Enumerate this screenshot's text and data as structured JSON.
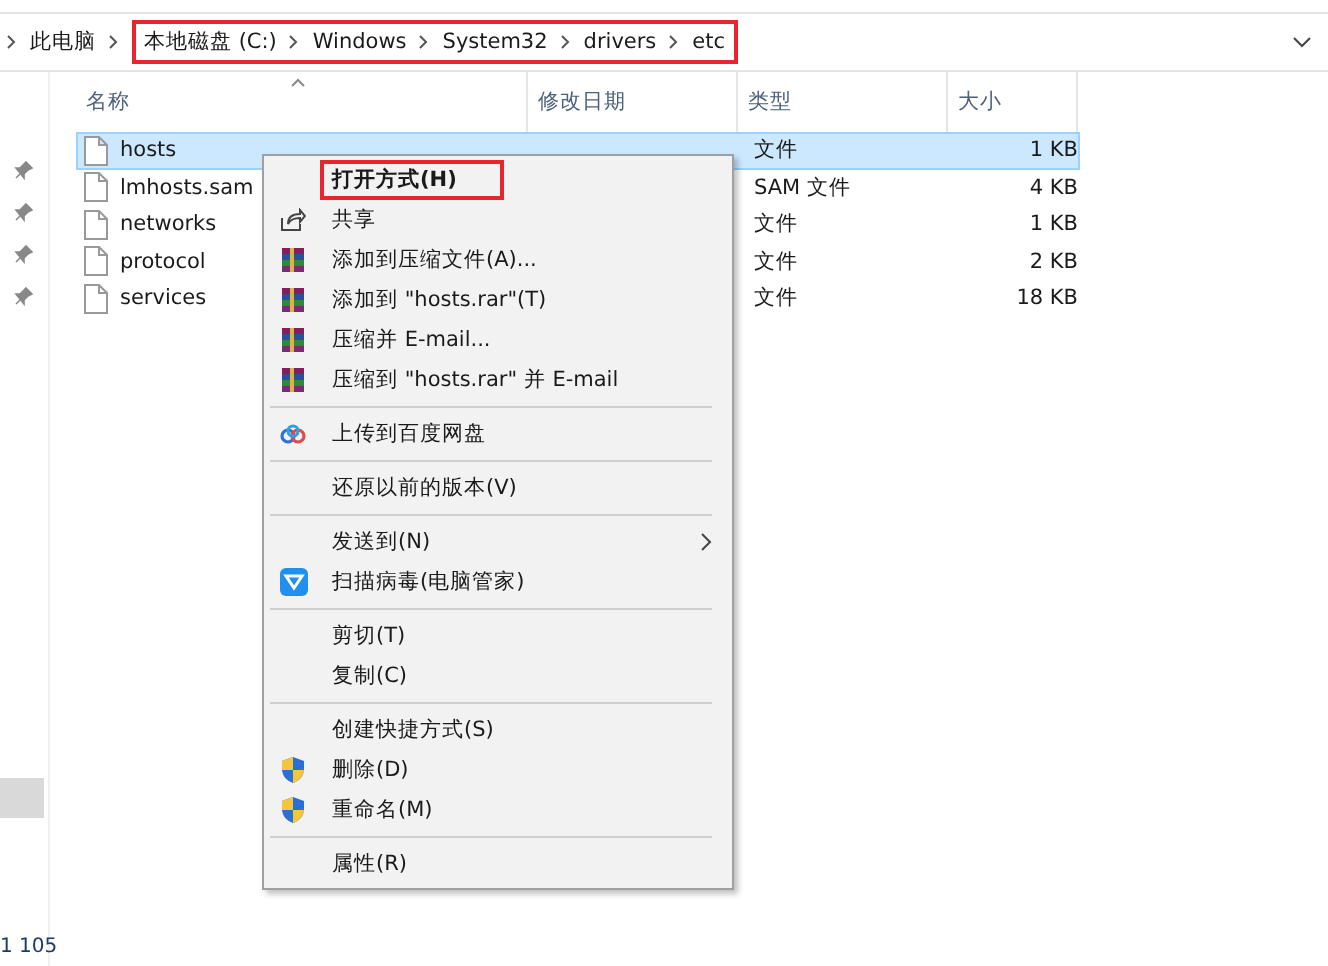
{
  "address_bar": {
    "root": "此电脑",
    "path": [
      "本地磁盘 (C:)",
      "Windows",
      "System32",
      "drivers",
      "etc"
    ],
    "path_highlighted": true
  },
  "table": {
    "columns": [
      "名称",
      "修改日期",
      "类型",
      "大小"
    ],
    "rows": [
      {
        "name": "hosts",
        "type": "文件",
        "size": "1 KB",
        "selected": true
      },
      {
        "name": "lmhosts.sam",
        "type": "SAM 文件",
        "size": "4 KB",
        "selected": false
      },
      {
        "name": "networks",
        "type": "文件",
        "size": "1 KB",
        "selected": false
      },
      {
        "name": "protocol",
        "type": "文件",
        "size": "2 KB",
        "selected": false
      },
      {
        "name": "services",
        "type": "文件",
        "size": "18 KB",
        "selected": false
      }
    ]
  },
  "status_bar": "1 105",
  "context_menu": {
    "items": [
      {
        "kind": "plain",
        "label": "打开方式(H)",
        "bold": true,
        "highlighted": true,
        "submenu": false
      },
      {
        "kind": "share",
        "label": "共享",
        "bold": false,
        "highlighted": false,
        "submenu": false
      },
      {
        "kind": "archive",
        "label": "添加到压缩文件(A)...",
        "bold": false,
        "highlighted": false,
        "submenu": false
      },
      {
        "kind": "archive",
        "label": "添加到 \"hosts.rar\"(T)",
        "bold": false,
        "highlighted": false,
        "submenu": false
      },
      {
        "kind": "archive",
        "label": "压缩并 E-mail...",
        "bold": false,
        "highlighted": false,
        "submenu": false
      },
      {
        "kind": "archive",
        "label": "压缩到 \"hosts.rar\" 并 E-mail",
        "bold": false,
        "highlighted": false,
        "submenu": false
      },
      {
        "kind": "separator"
      },
      {
        "kind": "cloud",
        "label": "上传到百度网盘",
        "bold": false,
        "highlighted": false,
        "submenu": false
      },
      {
        "kind": "separator"
      },
      {
        "kind": "plain",
        "label": "还原以前的版本(V)",
        "bold": false,
        "highlighted": false,
        "submenu": false
      },
      {
        "kind": "separator"
      },
      {
        "kind": "plain",
        "label": "发送到(N)",
        "bold": false,
        "highlighted": false,
        "submenu": true
      },
      {
        "kind": "scan",
        "label": "扫描病毒(电脑管家)",
        "bold": false,
        "highlighted": false,
        "submenu": false
      },
      {
        "kind": "separator"
      },
      {
        "kind": "plain",
        "label": "剪切(T)",
        "bold": false,
        "highlighted": false,
        "submenu": false
      },
      {
        "kind": "plain",
        "label": "复制(C)",
        "bold": false,
        "highlighted": false,
        "submenu": false
      },
      {
        "kind": "separator"
      },
      {
        "kind": "plain",
        "label": "创建快捷方式(S)",
        "bold": false,
        "highlighted": false,
        "submenu": false
      },
      {
        "kind": "admin",
        "label": "删除(D)",
        "bold": false,
        "highlighted": false,
        "submenu": false
      },
      {
        "kind": "admin",
        "label": "重命名(M)",
        "bold": false,
        "highlighted": false,
        "submenu": false
      },
      {
        "kind": "separator"
      },
      {
        "kind": "plain",
        "label": "属性(R)",
        "bold": false,
        "highlighted": false,
        "submenu": false
      }
    ]
  }
}
